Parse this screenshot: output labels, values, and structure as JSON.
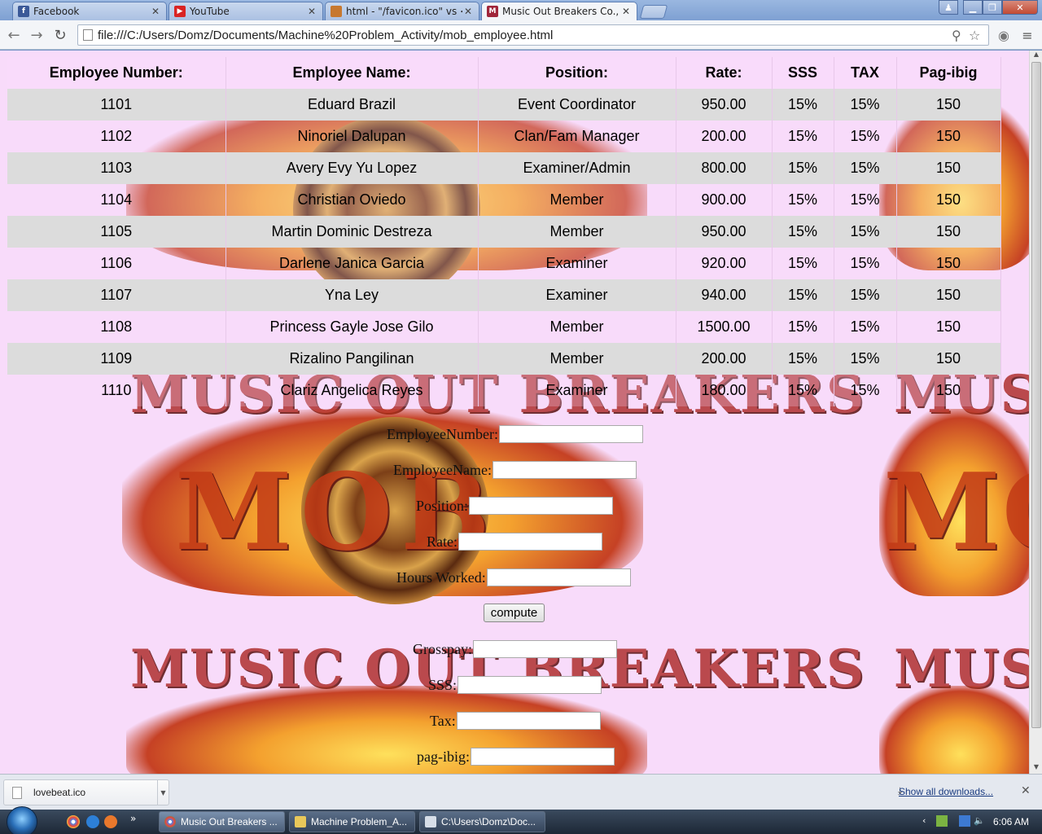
{
  "browser": {
    "tabs": [
      {
        "label": "Facebook",
        "icon": "facebook-icon",
        "color": "#3b5998"
      },
      {
        "label": "YouTube",
        "icon": "youtube-icon",
        "color": "#d92323"
      },
      {
        "label": "html - \"/favicon.ico\" vs <l",
        "icon": "stackoverflow-icon",
        "color": "#c7782f"
      },
      {
        "label": "Music Out Breakers Co., Li",
        "icon": "mob-icon",
        "color": "#a0263a"
      }
    ],
    "url": "file:///C:/Users/Domz/Documents/Machine%20Problem_Activity/mob_employee.html"
  },
  "table": {
    "headers": [
      "Employee Number:",
      "Employee Name:",
      "Position:",
      "Rate:",
      "SSS",
      "TAX",
      "Pag-ibig"
    ],
    "rows": [
      [
        "1101",
        "Eduard Brazil",
        "Event Coordinator",
        "950.00",
        "15%",
        "15%",
        "150"
      ],
      [
        "1102",
        "Ninoriel Dalupan",
        "Clan/Fam Manager",
        "200.00",
        "15%",
        "15%",
        "150"
      ],
      [
        "1103",
        "Avery Evy Yu Lopez",
        "Examiner/Admin",
        "800.00",
        "15%",
        "15%",
        "150"
      ],
      [
        "1104",
        "Christian Oviedo",
        "Member",
        "900.00",
        "15%",
        "15%",
        "150"
      ],
      [
        "1105",
        "Martin Dominic Destreza",
        "Member",
        "950.00",
        "15%",
        "15%",
        "150"
      ],
      [
        "1106",
        "Darlene Janica Garcia",
        "Examiner",
        "920.00",
        "15%",
        "15%",
        "150"
      ],
      [
        "1107",
        "Yna Ley",
        "Examiner",
        "940.00",
        "15%",
        "15%",
        "150"
      ],
      [
        "1108",
        "Princess Gayle Jose Gilo",
        "Member",
        "1500.00",
        "15%",
        "15%",
        "150"
      ],
      [
        "1109",
        "Rizalino Pangilinan",
        "Member",
        "200.00",
        "15%",
        "15%",
        "150"
      ],
      [
        "1110",
        "Clariz Angelica Reyes",
        "Examiner",
        "180.00",
        "15%",
        "15%",
        "150"
      ]
    ]
  },
  "form": {
    "employee_number_label": "EmployeeNumber:",
    "employee_name_label": "EmployeeName:",
    "position_label": "Position:",
    "rate_label": "Rate:",
    "hours_worked_label": "Hours Worked:",
    "compute_label": "compute",
    "grosspay_label": "Grosspay:",
    "sss_label": "SSS:",
    "tax_label": "Tax:",
    "pagibig_label": "pag-ibig:"
  },
  "background": {
    "banner_text": "MUSIC OUT BREAKERS",
    "logo_text": "MOB"
  },
  "downloads": {
    "file_name": "lovebeat.ico",
    "show_all": "Show all downloads..."
  },
  "taskbar": {
    "items": [
      "Music Out Breakers ...",
      "Machine Problem_A...",
      "C:\\Users\\Domz\\Doc..."
    ],
    "clock": "6:06 AM"
  }
}
